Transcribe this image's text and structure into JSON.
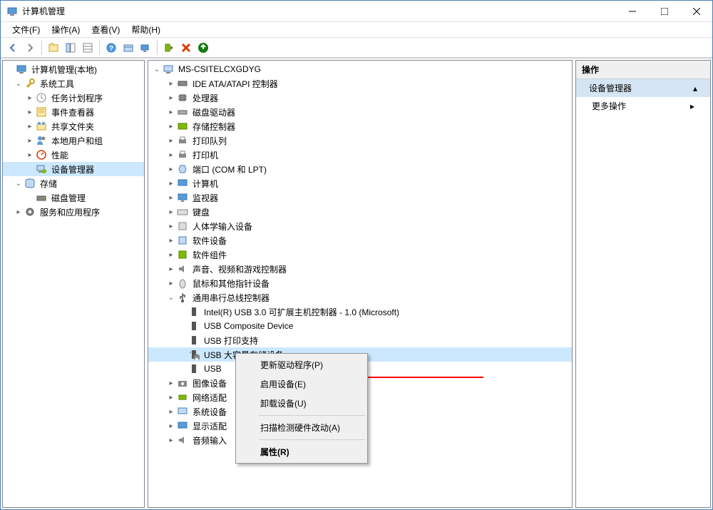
{
  "window": {
    "title": "计算机管理"
  },
  "menubar": {
    "file": "文件(F)",
    "action": "操作(A)",
    "view": "查看(V)",
    "help": "帮助(H)"
  },
  "left_tree": {
    "root": "计算机管理(本地)",
    "system_tools": "系统工具",
    "task_scheduler": "任务计划程序",
    "event_viewer": "事件查看器",
    "shared_folders": "共享文件夹",
    "local_users": "本地用户和组",
    "performance": "性能",
    "device_manager": "设备管理器",
    "storage": "存储",
    "disk_management": "磁盘管理",
    "services_apps": "服务和应用程序"
  },
  "device_tree": {
    "root": "MS-CSITELCXGDYG",
    "ide": "IDE ATA/ATAPI 控制器",
    "processors": "处理器",
    "disk_drives": "磁盘驱动器",
    "storage_controllers": "存储控制器",
    "print_queues": "打印队列",
    "printers": "打印机",
    "ports": "端口 (COM 和 LPT)",
    "computer": "计算机",
    "monitors": "监视器",
    "keyboards": "键盘",
    "hid": "人体学输入设备",
    "software_devices": "软件设备",
    "software_components": "软件组件",
    "audio_game": "声音、视频和游戏控制器",
    "mice": "鼠标和其他指针设备",
    "usb_controllers": "通用串行总线控制器",
    "usb_xhci": "Intel(R) USB 3.0 可扩展主机控制器 - 1.0 (Microsoft)",
    "usb_composite": "USB Composite Device",
    "usb_print": "USB 打印支持",
    "usb_mass_storage": "USB 大容量存储设备",
    "usb_short": "USB",
    "imaging": "图像设备",
    "network": "网络适配",
    "system_devices": "系统设备",
    "display": "显示适配",
    "audio_inputs": "音频输入"
  },
  "context_menu": {
    "update_driver": "更新驱动程序(P)",
    "enable_device": "启用设备(E)",
    "uninstall_device": "卸载设备(U)",
    "scan_hardware": "扫描检测硬件改动(A)",
    "properties": "属性(R)"
  },
  "actions_pane": {
    "header": "操作",
    "main_action": "设备管理器",
    "more_actions": "更多操作"
  }
}
